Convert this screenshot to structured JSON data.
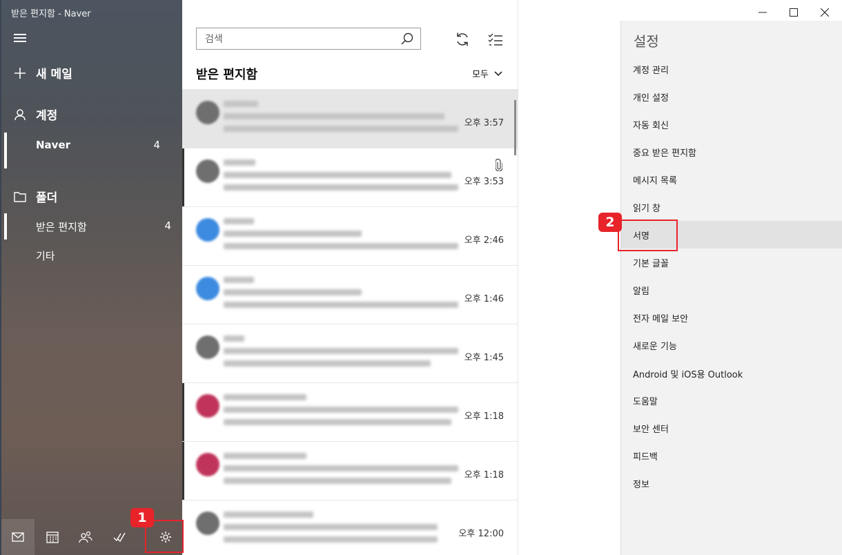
{
  "window": {
    "title": "받은 편지함 - Naver"
  },
  "sidebar": {
    "new_mail": "새 메일",
    "accounts_label": "계정",
    "account": {
      "name": "Naver",
      "count": "4"
    },
    "folders_label": "폴더",
    "folders": [
      {
        "name": "받은 편지함",
        "count": "4"
      },
      {
        "name": "기타",
        "count": ""
      }
    ]
  },
  "list": {
    "search_placeholder": "검색",
    "title": "받은 편지함",
    "filter": "모두",
    "messages": [
      {
        "time": "오후 3:57",
        "avatar_color": "#6f6f6f"
      },
      {
        "time": "오후 3:53",
        "avatar_color": "#6f6f6f"
      },
      {
        "time": "오후 2:46",
        "avatar_color": "#3d8be0"
      },
      {
        "time": "오후 1:46",
        "avatar_color": "#3d8be0"
      },
      {
        "time": "오후 1:45",
        "avatar_color": "#6f6f6f"
      },
      {
        "time": "오후 1:18",
        "avatar_color": "#c0345a"
      },
      {
        "time": "오후 1:18",
        "avatar_color": "#c0345a"
      },
      {
        "time": "오후 12:00",
        "avatar_color": "#6f6f6f"
      }
    ]
  },
  "settings": {
    "title": "설정",
    "items": [
      "계정 관리",
      "개인 설정",
      "자동 회신",
      "중요 받은 편지함",
      "메시지 목록",
      "읽기 창",
      "서명",
      "기본 글꼴",
      "알림",
      "전자 메일 보안",
      "새로운 기능",
      "Android 및 iOS용 Outlook",
      "도움말",
      "보안 센터",
      "피드백",
      "정보"
    ]
  },
  "annotations": {
    "badge1": "1",
    "badge2": "2"
  },
  "colors": {
    "annotation": "#e8232a",
    "selected_row": "#e6e6e6",
    "settings_bg": "#f2f2f2"
  },
  "icons": [
    "hamburger-icon",
    "plus-icon",
    "person-icon",
    "folder-icon",
    "mail-icon",
    "calendar-icon",
    "people-icon",
    "todo-icon",
    "gear-icon",
    "search-icon",
    "sync-icon",
    "select-icon",
    "chevron-down-icon",
    "paperclip-icon",
    "minimize-icon",
    "maximize-icon",
    "close-icon"
  ]
}
